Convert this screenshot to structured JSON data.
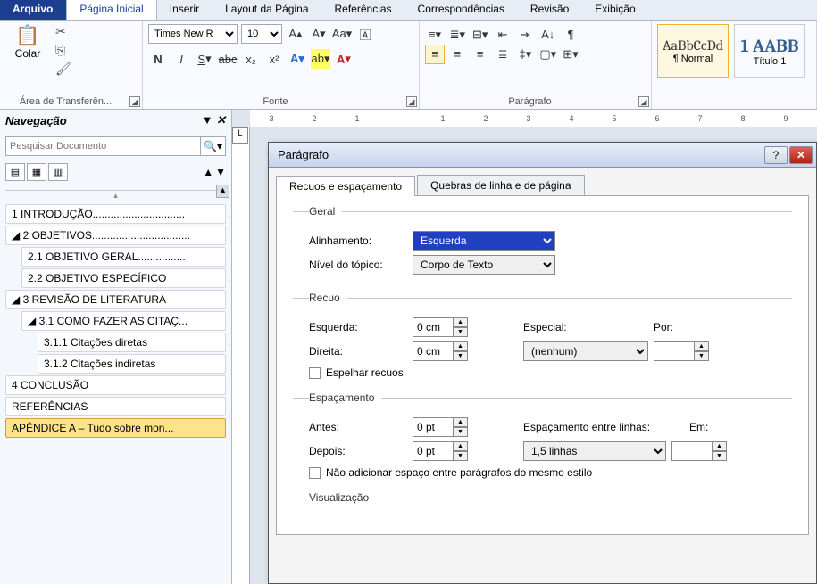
{
  "tabs": {
    "arquivo": "Arquivo",
    "inicial": "Página Inicial",
    "inserir": "Inserir",
    "layout": "Layout da Página",
    "referencias": "Referências",
    "corresp": "Correspondências",
    "revisao": "Revisão",
    "exibicao": "Exibição"
  },
  "ribbon": {
    "clip": {
      "label": "Área de Transferên...",
      "paste": "Colar"
    },
    "font": {
      "label": "Fonte",
      "name": "Times New R",
      "size": "10"
    },
    "para": {
      "label": "Parágrafo"
    },
    "styles": {
      "normal_preview": "AaBbCcDd",
      "normal_label": "¶ Normal",
      "t1_preview": "1 AABB",
      "t1_label": "Título 1"
    }
  },
  "nav": {
    "title": "Navegação",
    "search_ph": "Pesquisar Documento",
    "items": [
      {
        "l": 1,
        "t": "1 INTRODUÇÃO..............................."
      },
      {
        "l": 1,
        "t": "2 OBJETIVOS.................................",
        "exp": true
      },
      {
        "l": 2,
        "t": "2.1 OBJETIVO GERAL................"
      },
      {
        "l": 2,
        "t": "2.2 OBJETIVO ESPECÍFICO"
      },
      {
        "l": 1,
        "t": "3 REVISÃO DE LITERATURA",
        "exp": true
      },
      {
        "l": 2,
        "t": "3.1 COMO FAZER AS CITAÇ...",
        "exp": true
      },
      {
        "l": 3,
        "t": "3.1.1 Citações diretas"
      },
      {
        "l": 3,
        "t": "3.1.2 Citações indiretas"
      },
      {
        "l": 1,
        "t": "4 CONCLUSÃO"
      },
      {
        "l": 1,
        "t": "REFERÊNCIAS"
      },
      {
        "l": 1,
        "t": "APÊNDICE A – Tudo sobre mon...",
        "sel": true
      }
    ]
  },
  "ruler": [
    "3",
    "2",
    "1",
    "",
    "1",
    "2",
    "3",
    "4",
    "5",
    "6",
    "7",
    "8",
    "9"
  ],
  "dlg": {
    "title": "Parágrafo",
    "tab1": "Recuos e espaçamento",
    "tab2": "Quebras de linha e de página",
    "geral": "Geral",
    "alinhamento": "Alinhamento:",
    "alin_val": "Esquerda",
    "nivel": "Nível do tópico:",
    "nivel_val": "Corpo de Texto",
    "recuo": "Recuo",
    "esquerda": "Esquerda:",
    "esq_val": "0 cm",
    "direita": "Direita:",
    "dir_val": "0 cm",
    "especial": "Especial:",
    "esp_val": "(nenhum)",
    "por": "Por:",
    "espelhar": "Espelhar recuos",
    "espac": "Espaçamento",
    "antes": "Antes:",
    "antes_val": "0 pt",
    "depois": "Depois:",
    "depois_val": "0 pt",
    "entre": "Espaçamento entre linhas:",
    "entre_val": "1,5 linhas",
    "em": "Em:",
    "naoadd": "Não adicionar espaço entre parágrafos do mesmo estilo",
    "visual": "Visualização"
  }
}
